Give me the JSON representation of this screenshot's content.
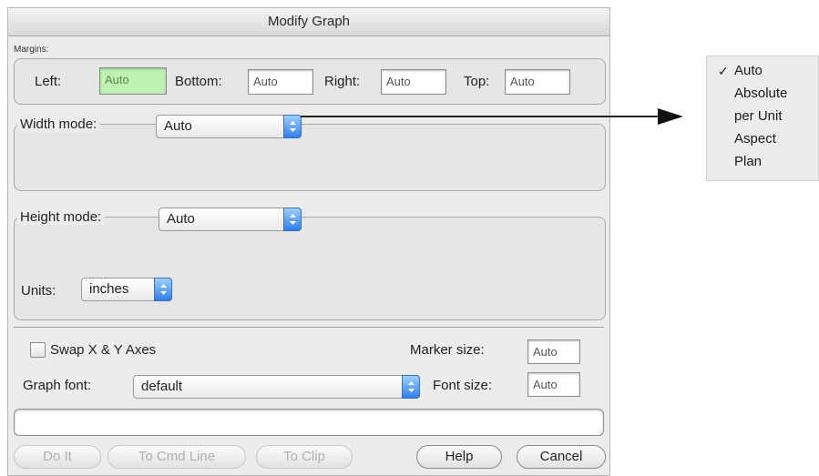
{
  "window": {
    "title": "Modify Graph"
  },
  "margins": {
    "group_label": "Margins:",
    "left_label": "Left:",
    "left_value": "Auto",
    "bottom_label": "Bottom:",
    "bottom_value": "Auto",
    "right_label": "Right:",
    "right_value": "Auto",
    "top_label": "Top:",
    "top_value": "Auto"
  },
  "width_mode": {
    "label": "Width mode:",
    "value": "Auto"
  },
  "height_mode": {
    "label": "Height mode:",
    "value": "Auto"
  },
  "units": {
    "label": "Units:",
    "value": "inches"
  },
  "options": {
    "swap_label": "Swap X & Y Axes",
    "marker_size_label": "Marker size:",
    "marker_size_value": "Auto",
    "graph_font_label": "Graph font:",
    "graph_font_value": "default",
    "font_size_label": "Font size:",
    "font_size_value": "Auto"
  },
  "command_line": {
    "value": ""
  },
  "buttons": {
    "do_it": "Do It",
    "to_cmd_line": "To Cmd Line",
    "to_clip": "To Clip",
    "help": "Help",
    "cancel": "Cancel"
  },
  "width_mode_menu": {
    "items": [
      "Auto",
      "Absolute",
      "per Unit",
      "Aspect",
      "Plan"
    ],
    "checked_mark": "✓"
  },
  "icons": [
    "popup-arrows-icon",
    "checkbox-icon",
    "checkmark-icon",
    "arrow-right-icon"
  ]
}
